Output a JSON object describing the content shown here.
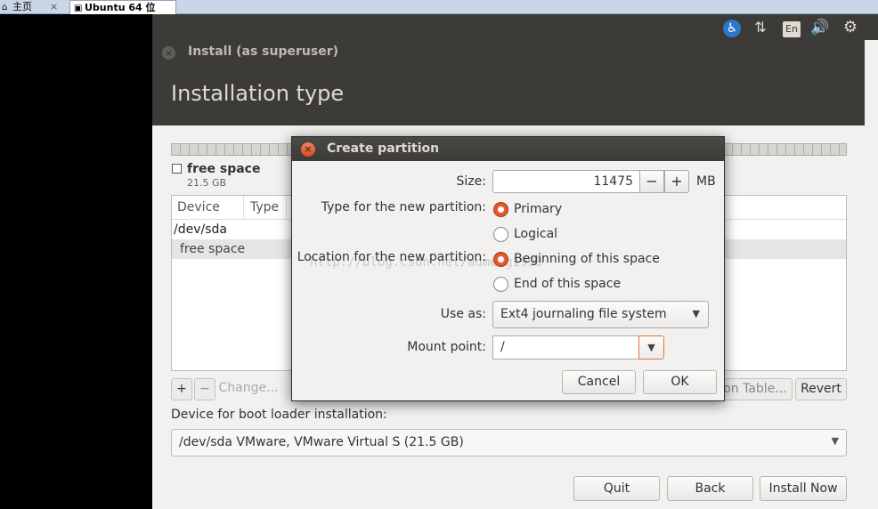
{
  "host_tabs": {
    "home": "主页",
    "active": "Ubuntu 64 位",
    "close": "×"
  },
  "tray": {
    "accessibility": "♿",
    "network": "⇅",
    "keyboard": "En",
    "sound": "🔊",
    "settings": "⚙"
  },
  "window": {
    "title": "Install (as superuser)",
    "close": "×"
  },
  "page": {
    "heading": "Installation type"
  },
  "free_space": {
    "label": "free space",
    "size": "21.5 GB"
  },
  "table": {
    "columns": [
      "Device",
      "Type"
    ],
    "rows": [
      {
        "device": "/dev/sda"
      },
      {
        "device": "free space"
      }
    ]
  },
  "table_buttons": {
    "add": "+",
    "remove": "−",
    "change": "Change...",
    "new_partition_table": "ion Table...",
    "revert": "Revert"
  },
  "bootloader": {
    "label": "Device for boot loader installation:",
    "value": "/dev/sda VMware, VMware Virtual S (21.5 GB)"
  },
  "nav_buttons": {
    "quit": "Quit",
    "back": "Back",
    "install_now": "Install Now"
  },
  "dialog": {
    "title": "Create partition",
    "close": "×",
    "size_label": "Size:",
    "size_value": "11475",
    "size_minus": "−",
    "size_plus": "+",
    "size_unit": "MB",
    "type_label": "Type for the new partition:",
    "type_primary": "Primary",
    "type_logical": "Logical",
    "location_label": "Location for the new partition:",
    "location_beginning": "Beginning of this space",
    "location_end": "End of this space",
    "use_as_label": "Use as:",
    "use_as_value": "Ext4 journaling file system",
    "mount_label": "Mount point:",
    "mount_value": "/",
    "cancel": "Cancel",
    "ok": "OK",
    "watermark": "http://blog.csdn.net/admeng1998"
  },
  "icons": {
    "dropdown_arrow": "▼"
  }
}
